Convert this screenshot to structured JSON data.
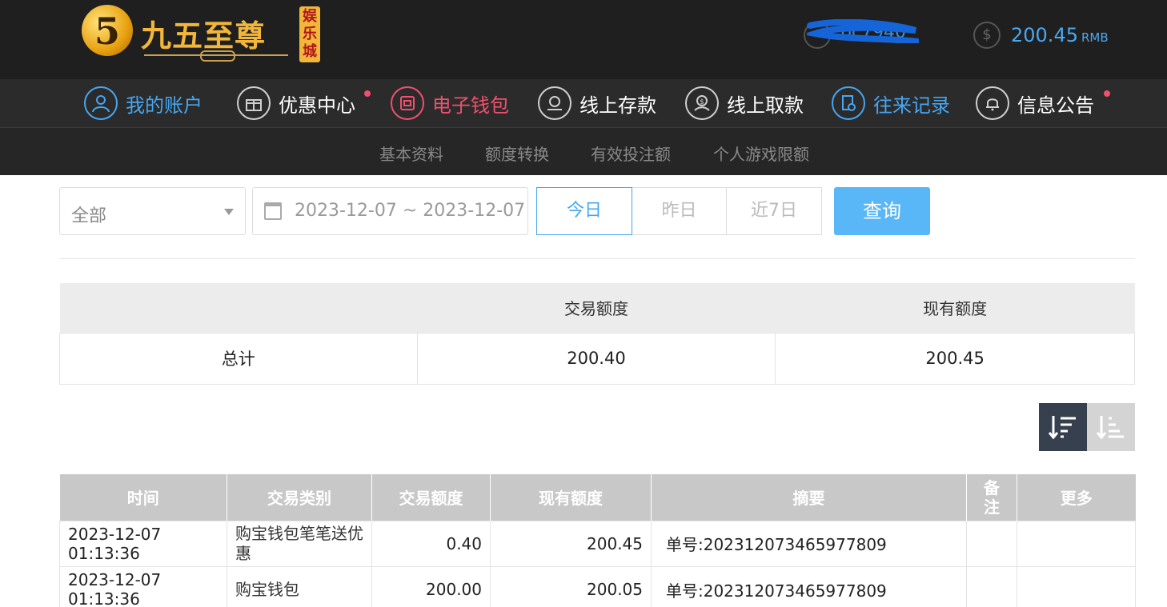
{
  "header": {
    "logo_mark": "5",
    "logo_name": "九五至尊",
    "logo_tag": "娱乐城",
    "username": "bc7940",
    "balance": "200.45",
    "currency": "RMB"
  },
  "nav": {
    "items": [
      {
        "label": "我的账户",
        "icon": "user-icon"
      },
      {
        "label": "优惠中心",
        "icon": "gift-icon"
      },
      {
        "label": "电子钱包",
        "icon": "wallet-icon"
      },
      {
        "label": "线上存款",
        "icon": "deposit-icon"
      },
      {
        "label": "线上取款",
        "icon": "withdraw-icon"
      },
      {
        "label": "往来记录",
        "icon": "records-icon"
      },
      {
        "label": "信息公告",
        "icon": "bell-icon"
      }
    ]
  },
  "subnav": {
    "items": [
      "基本资料",
      "额度转换",
      "有效投注额",
      "个人游戏限额"
    ]
  },
  "filters": {
    "type_select": "全部",
    "date_range": "2023-12-07 ~ 2023-12-07",
    "quick": [
      "今日",
      "昨日",
      "近7日"
    ],
    "search_label": "查询"
  },
  "summary": {
    "headers": [
      "",
      "交易额度",
      "现有额度"
    ],
    "row_label": "总计",
    "trade_amount": "200.40",
    "current_amount": "200.45"
  },
  "records": {
    "headers": [
      "时间",
      "交易类别",
      "交易额度",
      "现有额度",
      "摘要",
      "备注",
      "更多"
    ],
    "rows": [
      {
        "time": "2023-12-07 01:13:36",
        "type": "购宝钱包笔笔送优惠",
        "amount": "0.40",
        "balance": "200.45",
        "summary": "单号:202312073465977809",
        "note": "",
        "more": ""
      },
      {
        "time": "2023-12-07 01:13:36",
        "type": "购宝钱包",
        "amount": "200.00",
        "balance": "200.05",
        "summary": "单号:202312073465977809",
        "note": "",
        "more": ""
      }
    ]
  },
  "colors": {
    "accent_blue": "#46a6f2",
    "accent_red": "#f0506e",
    "header_bg": "#1f1f1f",
    "search_button": "#5ab7f7"
  }
}
